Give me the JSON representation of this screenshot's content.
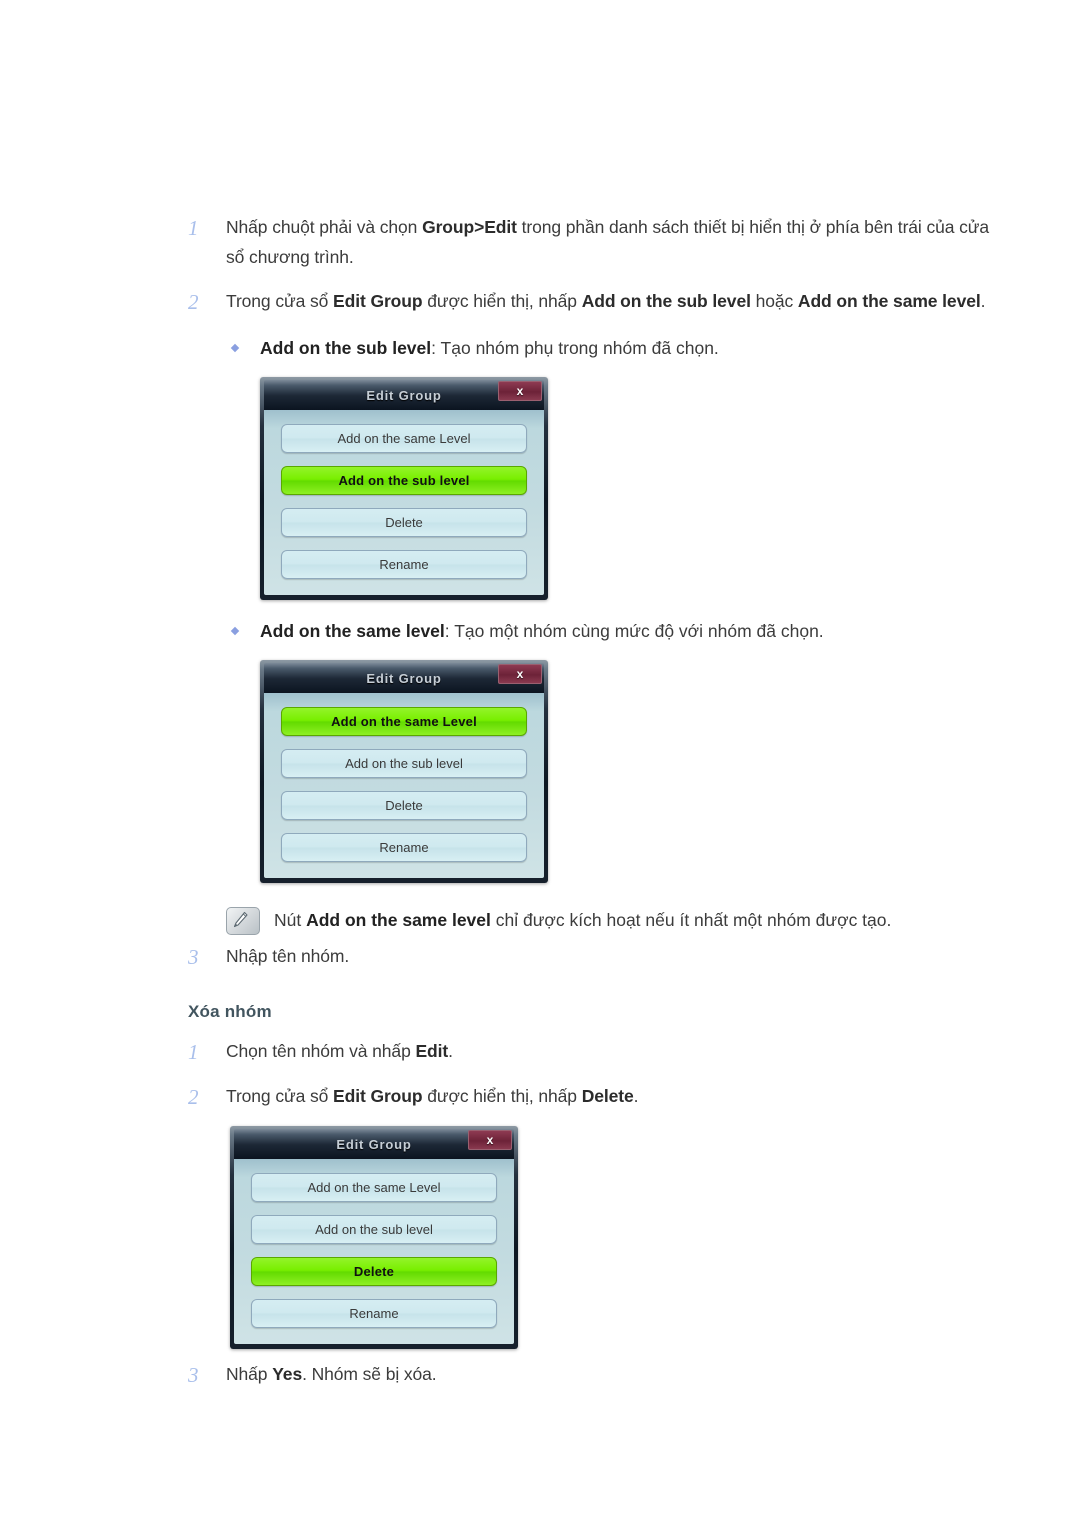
{
  "document": {
    "steps_group_a": [
      {
        "number": "1",
        "parts": [
          {
            "t": "Nhấp chuột phải và chọn ",
            "b": false
          },
          {
            "t": "Group>Edit",
            "b": true
          },
          {
            "t": " trong phần danh sách thiết bị hiển thị ở phía bên trái của cửa sổ chương trình.",
            "b": false
          }
        ]
      },
      {
        "number": "2",
        "parts": [
          {
            "t": "Trong cửa sổ ",
            "b": false
          },
          {
            "t": "Edit Group",
            "b": true
          },
          {
            "t": " được hiển thị, nhấp ",
            "b": false
          },
          {
            "t": "Add on the sub level",
            "b": true
          },
          {
            "t": " hoặc ",
            "b": false
          },
          {
            "t": "Add on the same level",
            "b": true
          },
          {
            "t": ".",
            "b": false
          }
        ]
      }
    ],
    "bullet_sub": [
      {
        "t": "Add on the sub level",
        "b": true
      },
      {
        "t": ": Tạo nhóm phụ trong nhóm đã chọn.",
        "b": false
      }
    ],
    "bullet_same": [
      {
        "t": "Add on the same level",
        "b": true
      },
      {
        "t": ": Tạo một nhóm cùng mức độ với nhóm đã chọn.",
        "b": false
      }
    ],
    "note": [
      {
        "t": "Nút ",
        "b": false
      },
      {
        "t": "Add on the same level",
        "b": true
      },
      {
        "t": " chỉ được kích hoạt nếu ít nhất một nhóm được tạo.",
        "b": false
      }
    ],
    "step3_a": {
      "number": "3",
      "parts": [
        {
          "t": "Nhập tên nhóm.",
          "b": false
        }
      ]
    },
    "section_heading": "Xóa nhóm",
    "steps_group_b": [
      {
        "number": "1",
        "parts": [
          {
            "t": "Chọn tên nhóm và nhấp ",
            "b": false
          },
          {
            "t": "Edit",
            "b": true
          },
          {
            "t": ".",
            "b": false
          }
        ]
      },
      {
        "number": "2",
        "parts": [
          {
            "t": "Trong cửa sổ ",
            "b": false
          },
          {
            "t": "Edit Group",
            "b": true
          },
          {
            "t": " được hiển thị, nhấp ",
            "b": false
          },
          {
            "t": "Delete",
            "b": true
          },
          {
            "t": ".",
            "b": false
          }
        ]
      }
    ],
    "step3_b": {
      "number": "3",
      "parts": [
        {
          "t": "Nhấp ",
          "b": false
        },
        {
          "t": "Yes",
          "b": true
        },
        {
          "t": ". Nhóm sẽ bị xóa.",
          "b": false
        }
      ]
    }
  },
  "dialogs": [
    {
      "id": "dialog-sub-level",
      "title": "Edit Group",
      "close_label": "x",
      "buttons": [
        {
          "label": "Add on the same Level",
          "active": false
        },
        {
          "label": "Add on the sub level",
          "active": true
        },
        {
          "label": "Delete",
          "active": false
        },
        {
          "label": "Rename",
          "active": false
        }
      ]
    },
    {
      "id": "dialog-same-level",
      "title": "Edit Group",
      "close_label": "x",
      "buttons": [
        {
          "label": "Add on the same Level",
          "active": true
        },
        {
          "label": "Add on the sub level",
          "active": false
        },
        {
          "label": "Delete",
          "active": false
        },
        {
          "label": "Rename",
          "active": false
        }
      ]
    },
    {
      "id": "dialog-delete",
      "title": "Edit Group",
      "close_label": "x",
      "buttons": [
        {
          "label": "Add on the same Level",
          "active": false
        },
        {
          "label": "Add on the sub level",
          "active": false
        },
        {
          "label": "Delete",
          "active": true
        },
        {
          "label": "Rename",
          "active": false
        }
      ]
    }
  ],
  "colors": {
    "step_number": "#a9bfeb",
    "body_text": "#3c3c3c",
    "section_heading": "#42555f",
    "bullet": "#8a9fe0",
    "dialog_active_button": "#79ef00",
    "dialog_button": "#cfe9ef",
    "dialog_titlebar": "#0b1420",
    "dialog_close": "#6d2238",
    "page_background": "#ffffff"
  }
}
